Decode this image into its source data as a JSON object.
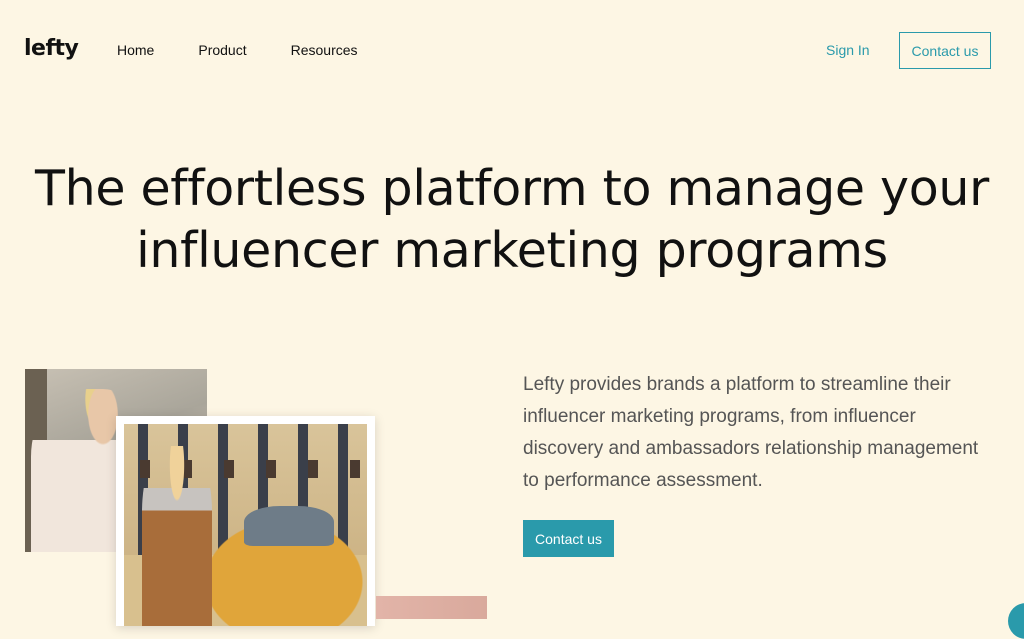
{
  "header": {
    "logo": "lefty",
    "nav": [
      {
        "label": "Home"
      },
      {
        "label": "Product"
      },
      {
        "label": "Resources"
      }
    ],
    "sign_in": "Sign In",
    "contact_label": "Contact us"
  },
  "hero": {
    "title_line1": "The effortless platform to manage your",
    "title_line2": "influencer marketing programs",
    "description": "Lefty provides brands a platform to streamline their influencer marketing programs, from influencer discovery and ambassadors relationship management to performance assessment.",
    "cta_label": "Contact us"
  },
  "colors": {
    "background": "#fdf6e4",
    "accent": "#2a9aab",
    "text": "#111111",
    "muted_text": "#555555"
  },
  "icons": {
    "chat": "chat-bubble-icon"
  }
}
